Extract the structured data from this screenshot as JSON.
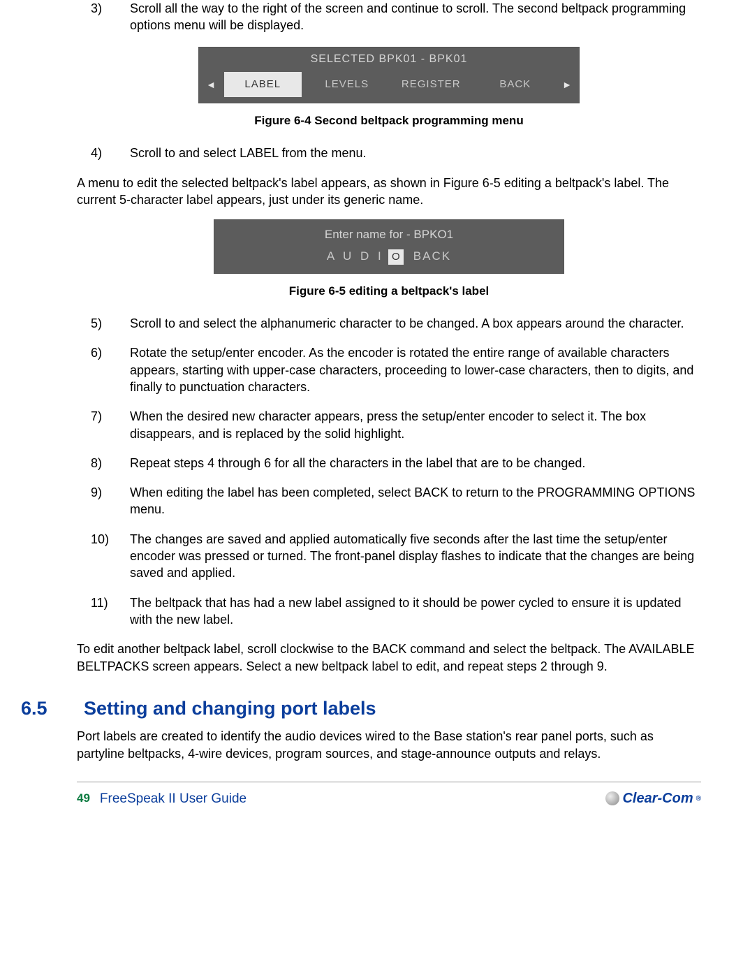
{
  "steps": {
    "s3_num": "3)",
    "s3": "Scroll all the way to the right of the screen and continue to scroll. The second beltpack programming options menu will be displayed.",
    "s4_num": "4)",
    "s4": "Scroll to and select LABEL from the menu.",
    "s5_num": "5)",
    "s5": "Scroll to and select the alphanumeric character to be changed. A box appears around the character.",
    "s6_num": "6)",
    "s6": "Rotate the setup/enter encoder. As the encoder is rotated the entire range of available characters appears, starting with upper-case characters, proceeding to lower-case characters, then to digits, and finally to punctuation characters.",
    "s7_num": "7)",
    "s7": "When the desired new character appears, press the setup/enter encoder to select it. The box disappears, and is replaced by the solid highlight.",
    "s8_num": "8)",
    "s8": "Repeat steps 4 through 6 for all the characters in the label that are to be changed.",
    "s9_num": "9)",
    "s9": "When editing the label has been completed, select BACK to return to the PROGRAMMING OPTIONS menu.",
    "s10_num": "10)",
    "s10": "The changes are saved and applied automatically five seconds after the last time the setup/enter encoder was pressed or turned. The front-panel display flashes to indicate that the changes are being saved and applied.",
    "s11_num": "11)",
    "s11": "The beltpack that has had a new label assigned to it should be power cycled to ensure it is updated with the new label."
  },
  "fig1": {
    "title": "SELECTED BPK01 - BPK01",
    "left_arrow": "◄",
    "right_arrow": "►",
    "tab1": "LABEL",
    "tab2": "LEVELS",
    "tab3": "REGISTER",
    "tab4": "BACK",
    "caption": "Figure 6-4 Second beltpack programming menu"
  },
  "para_after4": "A menu to edit the selected beltpack's label appears, as shown in Figure 6-5 editing a beltpack's label. The current 5-character label appears, just under its generic name.",
  "fig2": {
    "title": "Enter name for - BPKO1",
    "chars_left": "A  U  D  I",
    "char_sel": "O",
    "back": "BACK",
    "caption": "Figure 6-5 editing a beltpack's label"
  },
  "para_after11": "To edit another beltpack label, scroll clockwise to the BACK command and select the beltpack. The AVAILABLE BELTPACKS screen appears. Select a new beltpack label to edit, and repeat steps 2 through 9.",
  "section": {
    "num": "6.5",
    "title": "Setting and changing port labels",
    "body": "Port labels are created to identify the audio devices wired to the Base station's rear panel ports, such as partyline beltpacks, 4-wire devices, program sources, and stage-announce outputs and relays."
  },
  "footer": {
    "page": "49",
    "guide": "FreeSpeak II User Guide",
    "brand": "Clear-Com"
  }
}
